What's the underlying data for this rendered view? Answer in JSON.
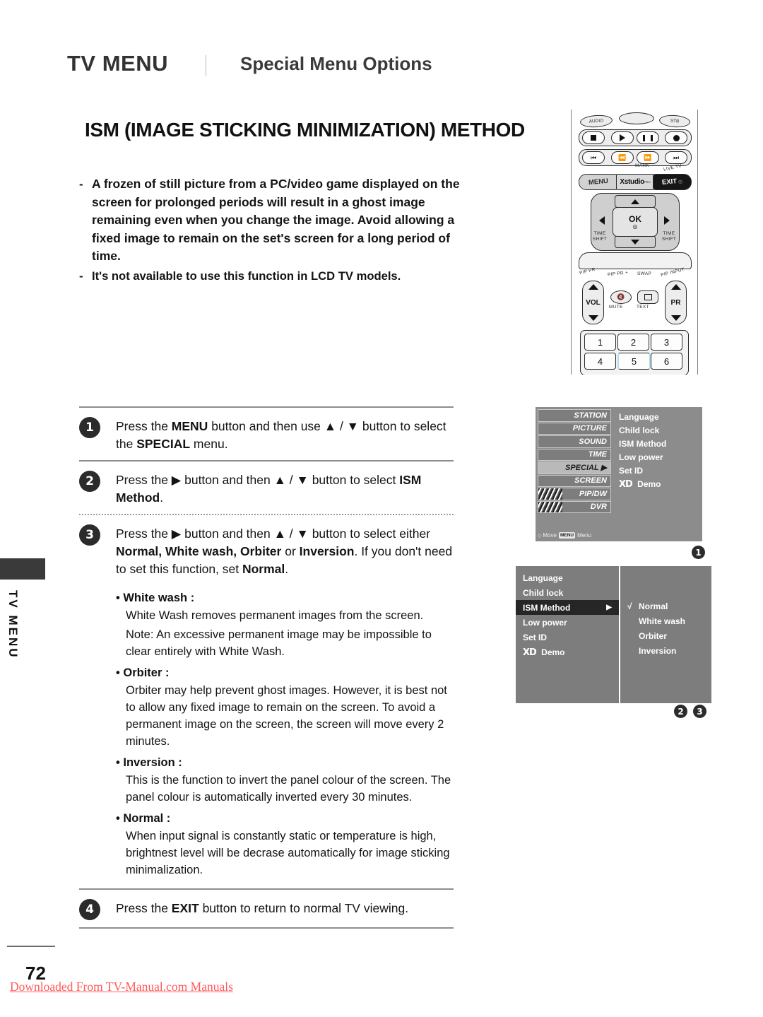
{
  "header": {
    "title": "TV MENU",
    "subtitle": "Special Menu Options"
  },
  "section_title": "ISM (IMAGE STICKING MINIMIZATION) METHOD",
  "intro": {
    "dash": "-",
    "items": [
      "A frozen of still picture from a PC/video game displayed on the screen for prolonged periods will result in a ghost image remaining even when you change the image. Avoid allowing a fixed image to remain on the set's screen for a long period of time.",
      "It's not available to use this function in  LCD TV models."
    ]
  },
  "steps": [
    {
      "num": "1",
      "parts": [
        {
          "t": "Press the ",
          "b": false
        },
        {
          "t": "MENU",
          "b": true
        },
        {
          "t": " button and then use ▲ / ▼ button to select the ",
          "b": false
        },
        {
          "t": "SPECIAL",
          "b": true
        },
        {
          "t": " menu.",
          "b": false
        }
      ]
    },
    {
      "num": "2",
      "parts": [
        {
          "t": "Press the ▶ button and then ▲ / ▼ button to select ",
          "b": false
        },
        {
          "t": "ISM Method",
          "b": true
        },
        {
          "t": ".",
          "b": false
        }
      ]
    },
    {
      "num": "3",
      "parts": [
        {
          "t": "Press the ▶ button and then ▲ / ▼ button to select either ",
          "b": false
        },
        {
          "t": "Normal, White wash, Orbiter",
          "b": true
        },
        {
          "t": " or ",
          "b": false
        },
        {
          "t": "Inversion",
          "b": true
        },
        {
          "t": ". If you don't need to set this function, set ",
          "b": false
        },
        {
          "t": "Normal",
          "b": true
        },
        {
          "t": ".",
          "b": false
        }
      ]
    },
    {
      "num": "4",
      "parts": [
        {
          "t": "Press the ",
          "b": false
        },
        {
          "t": "EXIT",
          "b": true
        },
        {
          "t": " button to return to normal TV viewing.",
          "b": false
        }
      ]
    }
  ],
  "descriptions": [
    {
      "heading": "• White wash :",
      "paragraphs": [
        "White Wash removes permanent images from the screen.",
        "Note: An excessive permanent image may be impossible to clear entirely with White Wash."
      ]
    },
    {
      "heading": "• Orbiter :",
      "paragraphs": [
        "Orbiter may help prevent ghost images. However, it is best not to allow any fixed image to remain on the screen. To avoid a permanent image on the screen, the screen will move every 2 minutes."
      ]
    },
    {
      "heading": "• Inversion :",
      "paragraphs": [
        "This is the function to invert the panel colour of the screen. The panel colour is automatically inverted every 30 minutes."
      ]
    },
    {
      "heading": "• Normal :",
      "paragraphs": [
        "When input signal is constantly static or temperature is high, brightnest level will be decrase automatically for image sticking minimalization."
      ]
    }
  ],
  "side_tab": {
    "label": "TV MENU"
  },
  "footer": {
    "page_number": "72",
    "download_note": "Downloaded From TV-Manual.com Manuals",
    "note_color": "#ff5a5a"
  },
  "remote": {
    "top_labels": [
      "AUDIO",
      "STB"
    ],
    "transport_row1": [
      "stop-icon",
      "play-icon",
      "pause-icon",
      "record-icon"
    ],
    "transport_row2": [
      "skip-back-icon",
      "rewind-icon",
      "fast-forward-icon",
      "skip-forward-icon"
    ],
    "transport_row2_captions": [
      "",
      "MARK",
      "",
      "LIVE TV"
    ],
    "menu_row": [
      "MENU",
      "Xstudio",
      "EXIT"
    ],
    "xstudio_sup": "PRO",
    "nav": {
      "ok": "OK",
      "left_caption": "TIME SHIFT",
      "right_caption": "TIME SHIFT"
    },
    "pip_row": [
      "PIP PR -",
      "PIP PR +",
      "SWAP",
      "PIP INPUT"
    ],
    "vol_label": "VOL",
    "pr_label": "PR",
    "mute_label": "MUTE",
    "text_label": "TEXT",
    "numbers": [
      "1",
      "2",
      "3",
      "4",
      "5",
      "6"
    ]
  },
  "osd1": {
    "tabs": [
      {
        "label": "STATION",
        "selected": false,
        "thumb": false
      },
      {
        "label": "PICTURE",
        "selected": false,
        "thumb": false
      },
      {
        "label": "SOUND",
        "selected": false,
        "thumb": false
      },
      {
        "label": "TIME",
        "selected": false,
        "thumb": false
      },
      {
        "label": "SPECIAL ▶",
        "selected": true,
        "thumb": false
      },
      {
        "label": "SCREEN",
        "selected": false,
        "thumb": false
      },
      {
        "label": "PIP/DW",
        "selected": false,
        "thumb": true
      },
      {
        "label": "DVR",
        "selected": false,
        "thumb": true
      }
    ],
    "hint_move": "Move",
    "hint_menu_key": "MENU",
    "hint_menu": "Menu",
    "items": [
      "Language",
      "Child lock",
      "ISM Method",
      "Low power",
      "Set ID"
    ],
    "xd_item": {
      "logo": "XD",
      "label": "Demo"
    },
    "marker": "1"
  },
  "osd2": {
    "items": [
      {
        "label": "Language",
        "highlighted": false,
        "arrow": ""
      },
      {
        "label": "Child lock",
        "highlighted": false,
        "arrow": ""
      },
      {
        "label": "ISM Method",
        "highlighted": true,
        "arrow": "▶"
      },
      {
        "label": "Low power",
        "highlighted": false,
        "arrow": ""
      },
      {
        "label": "Set ID",
        "highlighted": false,
        "arrow": ""
      }
    ],
    "xd_item": {
      "logo": "XD",
      "label": "Demo"
    },
    "options": [
      {
        "label": "Normal",
        "checked": "√"
      },
      {
        "label": "White wash",
        "checked": ""
      },
      {
        "label": "Orbiter",
        "checked": ""
      },
      {
        "label": "Inversion",
        "checked": ""
      }
    ],
    "markers": [
      "2",
      "3"
    ]
  }
}
